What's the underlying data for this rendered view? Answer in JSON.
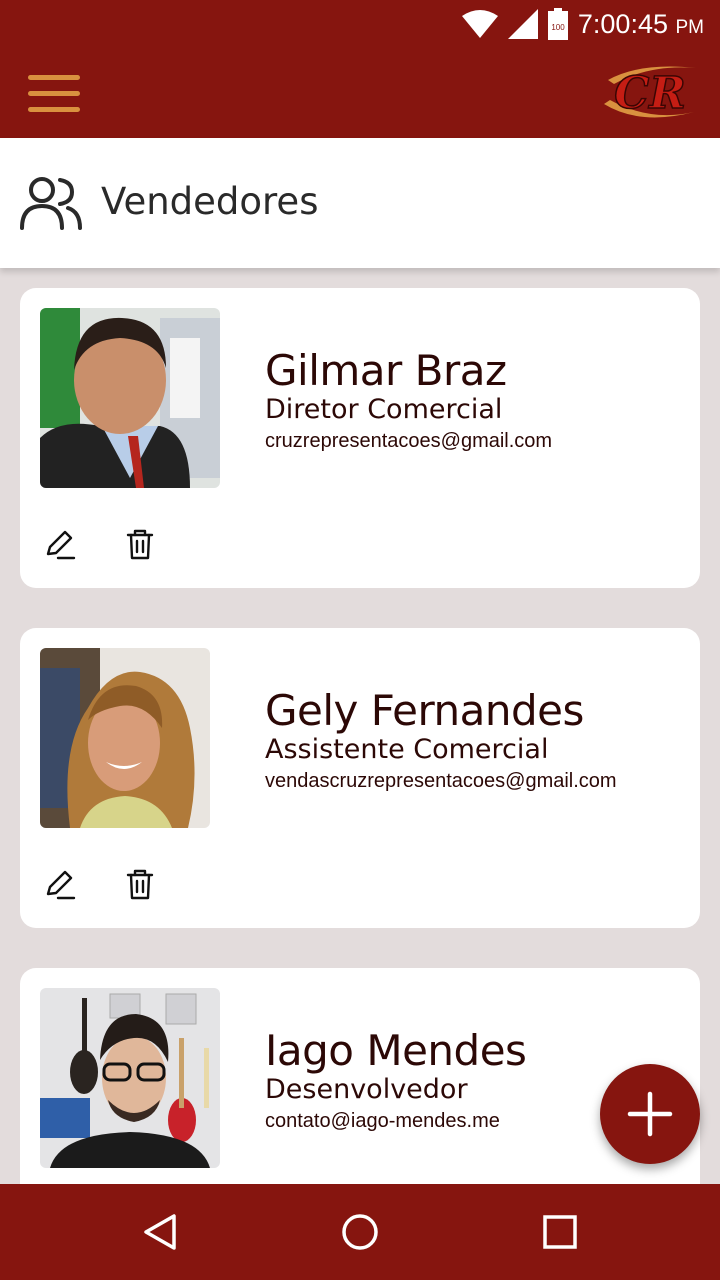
{
  "status_bar": {
    "time": "7:00:45",
    "ampm": "PM",
    "battery_level": "100",
    "icons": [
      "wifi-icon",
      "signal-icon",
      "battery-icon"
    ]
  },
  "app_bar": {
    "menu_icon": "hamburger-menu-icon",
    "logo_text": "CR"
  },
  "page": {
    "title": "Vendedores",
    "icon": "users-icon"
  },
  "sellers": [
    {
      "name": "Gilmar Braz",
      "role": "Diretor Comercial",
      "email": "cruzrepresentacoes@gmail.com"
    },
    {
      "name": "Gely Fernandes",
      "role": "Assistente Comercial",
      "email": "vendascruzrepresentacoes@gmail.com"
    },
    {
      "name": "Iago Mendes",
      "role": "Desenvolvedor",
      "email": "contato@iago-mendes.me"
    }
  ],
  "actions": {
    "edit_icon": "pencil-icon",
    "delete_icon": "trash-icon",
    "add_icon": "plus-icon"
  },
  "colors": {
    "primary": "#86150f",
    "accent": "#d9913f",
    "background": "#e3dcdc",
    "card": "#ffffff",
    "text_dark": "#2c0806"
  },
  "nav_bar": {
    "buttons": [
      "back-icon",
      "home-icon",
      "recents-icon"
    ]
  }
}
